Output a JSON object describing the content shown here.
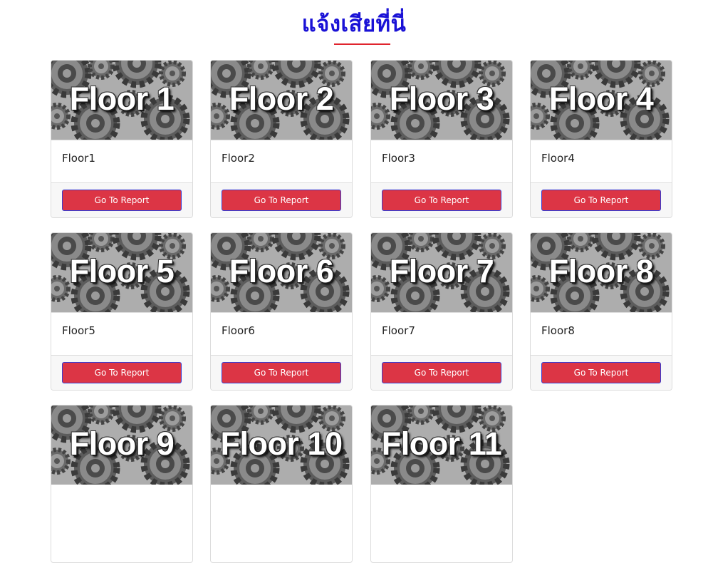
{
  "header": {
    "title": "แจ้งเสียที่นี่"
  },
  "cards": [
    {
      "image_text": "Floor 1",
      "title": "Floor1",
      "button_label": "Go To Report"
    },
    {
      "image_text": "Floor 2",
      "title": "Floor2",
      "button_label": "Go To Report"
    },
    {
      "image_text": "Floor 3",
      "title": "Floor3",
      "button_label": "Go To Report"
    },
    {
      "image_text": "Floor 4",
      "title": "Floor4",
      "button_label": "Go To Report"
    },
    {
      "image_text": "Floor 5",
      "title": "Floor5",
      "button_label": "Go To Report"
    },
    {
      "image_text": "Floor 6",
      "title": "Floor6",
      "button_label": "Go To Report"
    },
    {
      "image_text": "Floor 7",
      "title": "Floor7",
      "button_label": "Go To Report"
    },
    {
      "image_text": "Floor 8",
      "title": "Floor8",
      "button_label": "Go To Report"
    },
    {
      "image_text": "Floor 9"
    },
    {
      "image_text": "Floor 10"
    },
    {
      "image_text": "Floor 11"
    }
  ],
  "colors": {
    "title": "#1a12d6",
    "underline": "#e0242e",
    "button": "#dc3545"
  },
  "icons": {
    "card_background": "gears-image"
  }
}
